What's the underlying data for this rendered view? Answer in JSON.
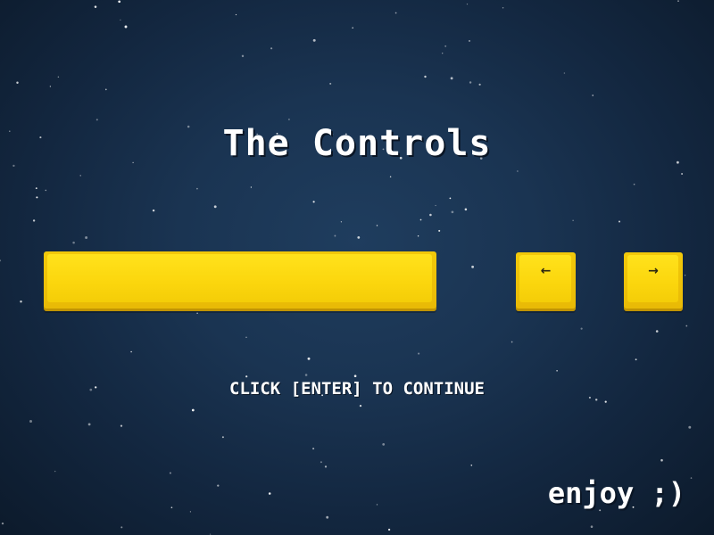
{
  "screen": {
    "title": "The Controls",
    "prompt": "CLICK [ENTER] TO CONTINUE",
    "footer": "enjoy ;)"
  },
  "keys": {
    "space": {
      "label": "",
      "icon": "spacebar-key"
    },
    "left": {
      "label": "←",
      "icon": "left-arrow-key"
    },
    "right": {
      "label": "→",
      "icon": "right-arrow-key"
    }
  },
  "colors": {
    "background": "#1a3452",
    "key": "#fbd60d",
    "text": "#ffffff"
  }
}
